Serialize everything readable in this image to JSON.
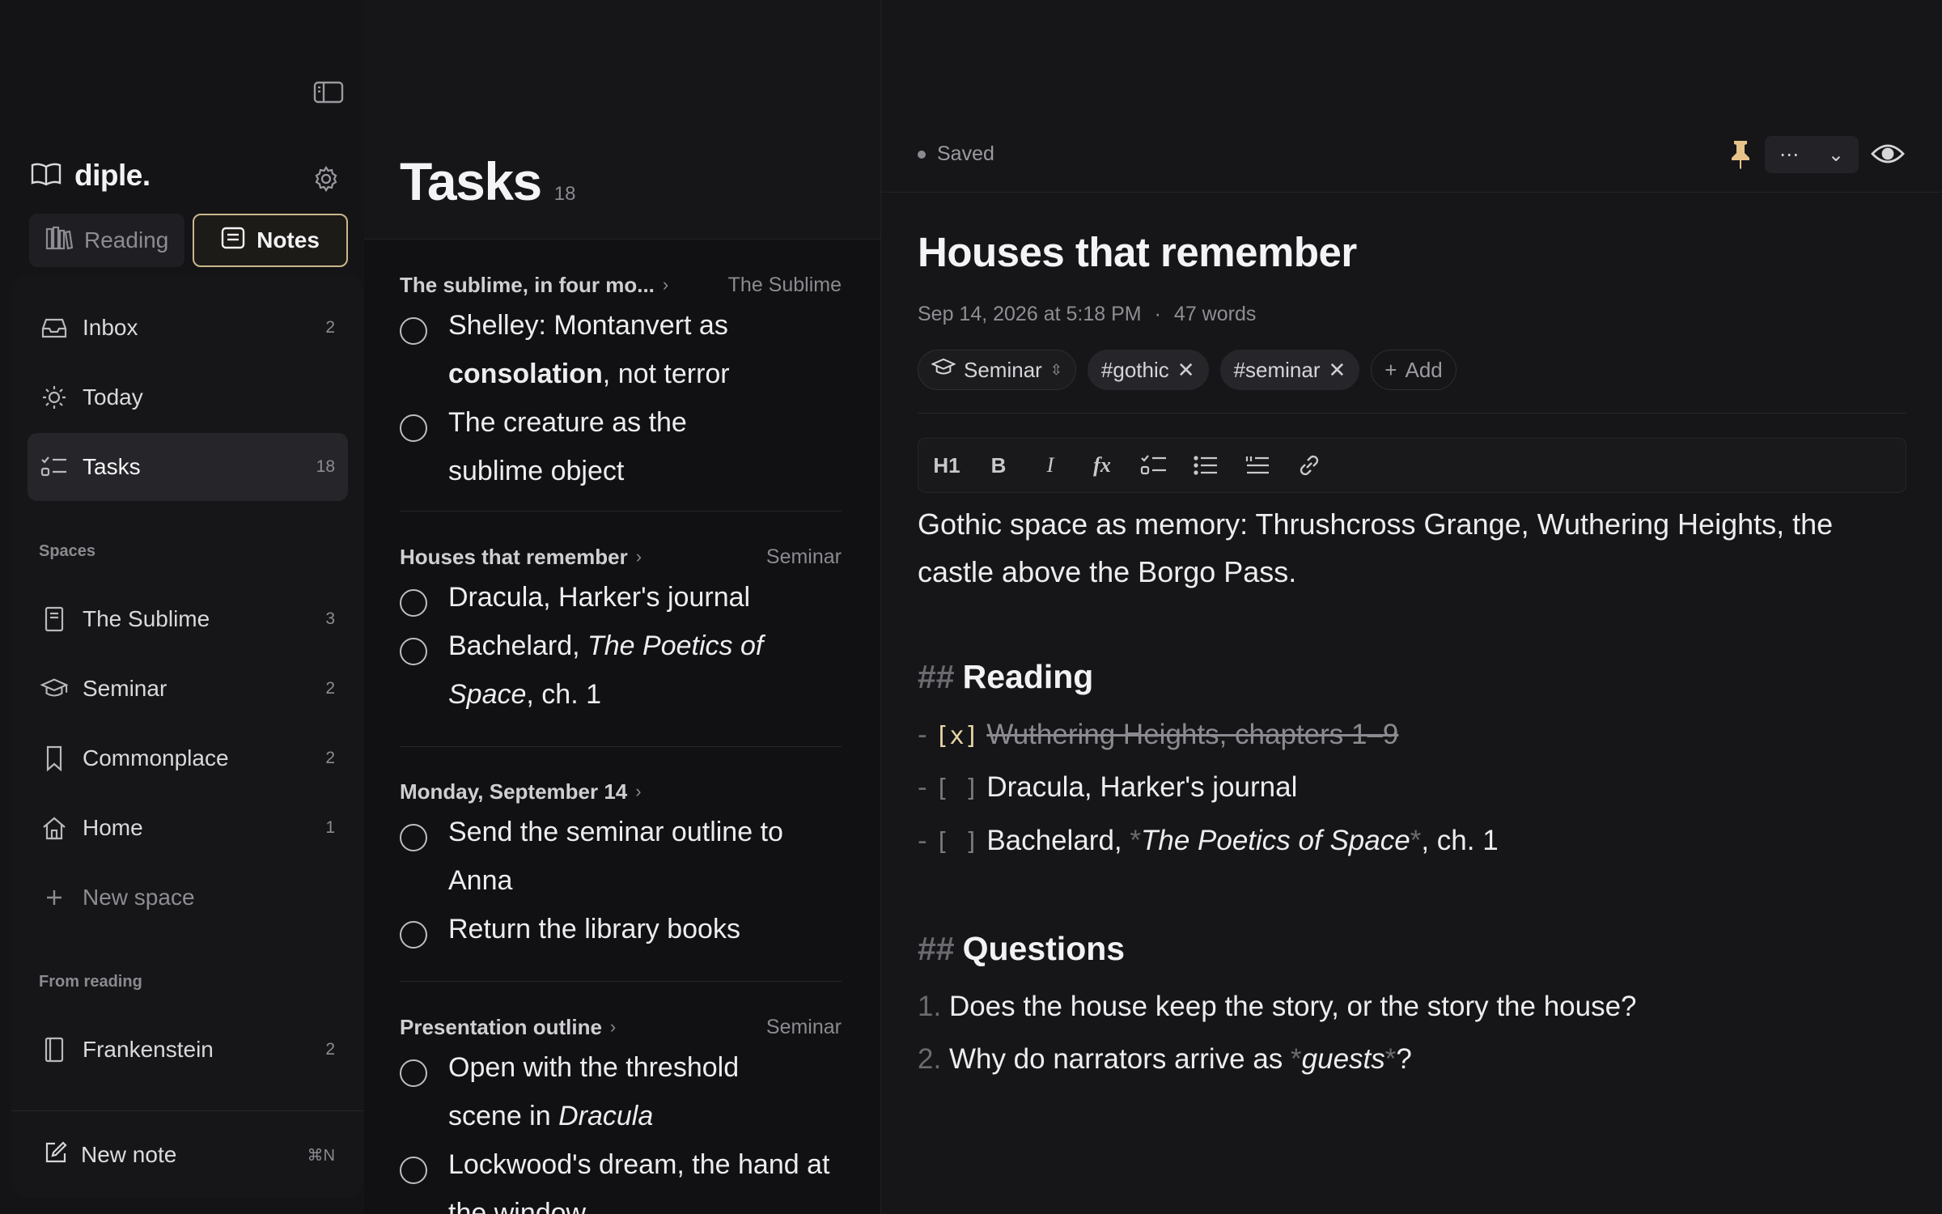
{
  "sidebar": {
    "brand": "diple.",
    "segments": {
      "reading": "Reading",
      "notes": "Notes"
    },
    "nav": [
      {
        "label": "Inbox",
        "count": "2"
      },
      {
        "label": "Today",
        "count": ""
      },
      {
        "label": "Tasks",
        "count": "18"
      }
    ],
    "spaces_title": "Spaces",
    "spaces": [
      {
        "label": "The Sublime",
        "count": "3"
      },
      {
        "label": "Seminar",
        "count": "2"
      },
      {
        "label": "Commonplace",
        "count": "2"
      },
      {
        "label": "Home",
        "count": "1"
      }
    ],
    "new_space": "New space",
    "from_reading_title": "From reading",
    "from_reading": [
      {
        "label": "Frankenstein",
        "count": "2"
      }
    ],
    "new_note": "New note",
    "new_note_shortcut": "⌘N"
  },
  "tasks": {
    "title": "Tasks",
    "count": "18",
    "groups": [
      {
        "title": "The sublime, in four mo...",
        "space": "The Sublime"
      },
      {
        "title": "Houses that remember",
        "space": "Seminar"
      },
      {
        "title": "Monday, September 14",
        "space": ""
      },
      {
        "title": "Presentation outline",
        "space": "Seminar"
      }
    ],
    "items": {
      "g0a_pre": "Shelley: Montanvert as ",
      "g0a_bold": "consolation",
      "g0a_post": ", not terror",
      "g0b": "The creature as the sublime object",
      "g1a": "Dracula, Harker's journal",
      "g1b_pre": "Bachelard, ",
      "g1b_it": "The Poetics of Space",
      "g1b_post": ", ch. 1",
      "g2a": "Send the seminar outline to Anna",
      "g2b": "Return the library books",
      "g3a_pre": "Open with the threshold scene in ",
      "g3a_it": "Dracula",
      "g3b": "Lockwood's dream, the hand at the window"
    }
  },
  "editor": {
    "status": "Saved",
    "title": "Houses that remember",
    "date": "Sep 14, 2026 at 5:18 PM",
    "dot": "·",
    "words": "47 words",
    "space_chip": "Seminar",
    "tags": [
      "#gothic",
      "#seminar"
    ],
    "add_label": "Add",
    "toolbar": {
      "h1": "H1",
      "bold": "B",
      "italic": "I",
      "fx": "fx"
    },
    "paragraph": "Gothic space as memory: Thrushcross Grange, Wuthering Heights, the castle above the Borgo Pass.",
    "h2_marker": "##",
    "reading_heading": "Reading",
    "list_marker": "-",
    "box_done": "[x]",
    "box_open": "[ ]",
    "reading_items": {
      "r1": "Wuthering Heights, chapters 1–9",
      "r2": "Dracula, Harker's journal",
      "r3_pre": "Bachelard, ",
      "r3_star": "*",
      "r3_it": "The Poetics of Space",
      "r3_post": ", ch. 1"
    },
    "questions_heading": "Questions",
    "q1_num": "1.",
    "q1": "Does the house keep the story, or the story the house?",
    "q2_num": "2.",
    "q2_pre": "Why do narrators arrive as ",
    "q2_it": "guests",
    "q2_post": "?"
  }
}
